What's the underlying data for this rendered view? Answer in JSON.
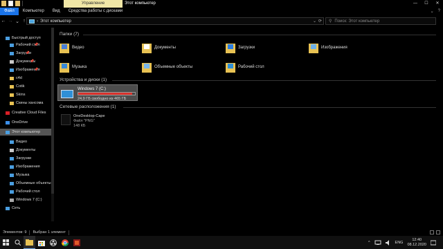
{
  "window": {
    "manage_tab": "Управление",
    "title": "Этот компьютер",
    "minimize": "—",
    "maximize": "☐",
    "close": "✕"
  },
  "ribbon": {
    "tabs": [
      "Файл",
      "Компьютер",
      "Вид",
      "Средства работы с дисками"
    ],
    "collapse": "⌄",
    "help": "?"
  },
  "nav": {
    "back": "←",
    "forward": "→",
    "recent": "⌄",
    "up": "↑"
  },
  "address": {
    "chevron": "›",
    "path": "Этот компьютер",
    "dropdown": "⌄",
    "refresh": "⟳"
  },
  "search": {
    "icon": "⚲",
    "placeholder": "Поиск: Этот компьютер"
  },
  "sidebar": {
    "items": [
      {
        "label": "Быстрый доступ",
        "icon": "star-icon"
      },
      {
        "label": "Рабочий стол",
        "icon": "desktop-icon",
        "pinned": true
      },
      {
        "label": "Загрузки",
        "icon": "download-icon",
        "pinned": true
      },
      {
        "label": "Документы",
        "icon": "documents-icon",
        "pinned": true
      },
      {
        "label": "Изображения",
        "icon": "pictures-icon",
        "pinned": true
      },
      {
        "label": "c4d",
        "icon": "folder-icon"
      },
      {
        "label": "Cotik",
        "icon": "folder-icon"
      },
      {
        "label": "Skins",
        "icon": "folder-icon"
      },
      {
        "label": "Скины хансома",
        "icon": "folder-icon"
      },
      {
        "label": "Creative Cloud Files",
        "icon": "creative-cloud-icon"
      },
      {
        "label": "OneDrive",
        "icon": "onedrive-icon"
      },
      {
        "label": "Этот компьютер",
        "icon": "pc-icon"
      },
      {
        "label": "Видео",
        "icon": "video-icon"
      },
      {
        "label": "Документы",
        "icon": "documents-icon"
      },
      {
        "label": "Загрузки",
        "icon": "download-icon"
      },
      {
        "label": "Изображения",
        "icon": "pictures-icon"
      },
      {
        "label": "Музыка",
        "icon": "music-icon"
      },
      {
        "label": "Объемные объекты",
        "icon": "3d-objects-icon"
      },
      {
        "label": "Рабочий стол",
        "icon": "desktop-icon"
      },
      {
        "label": "Windows 7 (C:)",
        "icon": "drive-icon"
      },
      {
        "label": "Сеть",
        "icon": "network-icon"
      }
    ],
    "pin_glyph": "📌"
  },
  "groups": {
    "folders": "Папки (7)",
    "devices": "Устройства и диски (1)",
    "network": "Сетевые расположения (1)"
  },
  "folders": [
    {
      "label": "Видео",
      "icon": "video-folder-icon"
    },
    {
      "label": "Документы",
      "icon": "documents-folder-icon"
    },
    {
      "label": "Загрузки",
      "icon": "downloads-folder-icon"
    },
    {
      "label": "Изображения",
      "icon": "pictures-folder-icon"
    },
    {
      "label": "Музыка",
      "icon": "music-folder-icon"
    },
    {
      "label": "Объемные объекты",
      "icon": "3d-objects-folder-icon"
    },
    {
      "label": "Рабочий стол",
      "icon": "desktop-folder-icon"
    }
  ],
  "drive": {
    "label": "Windows 7 (C:)",
    "free": "24,9 ГБ свободно из 465 ГБ",
    "used_fraction": 0.946,
    "bar_color": "#d9312b"
  },
  "network_item": {
    "name": "OneDesktop-Cape",
    "type": "Файл \"PNG\"",
    "size": "148 КБ"
  },
  "statusbar": {
    "count": "Элементов: 9",
    "selected": "Выбран 1 элемент"
  },
  "taskbar": {
    "apps": [
      "start-icon",
      "search-icon",
      "explorer-icon",
      "store-icon",
      "obs-icon",
      "chrome-icon",
      "app-icon"
    ],
    "tray_caret": "^",
    "lang": "ENG",
    "time": "12:40",
    "date": "08.12.2020"
  },
  "colors": {
    "accent": "#1a73e8",
    "manage_tab": "#f0e6a6",
    "folder": "#e8c253"
  }
}
